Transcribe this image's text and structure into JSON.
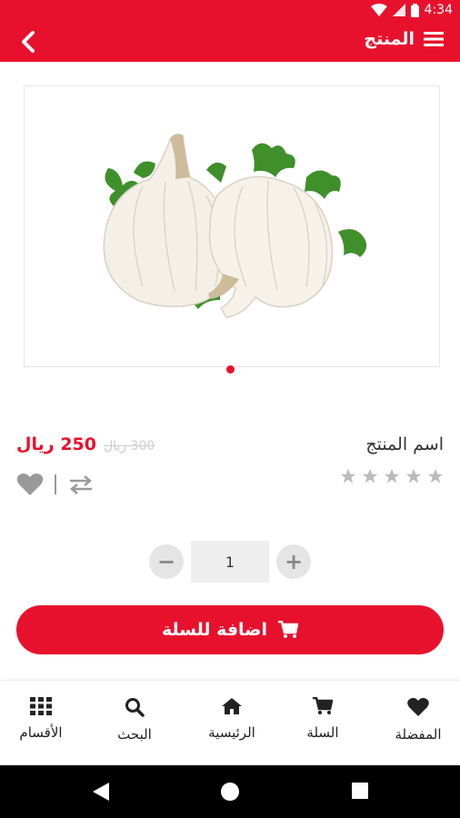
{
  "status_bar": {
    "time": "4:34"
  },
  "app_bar": {
    "title": "المنتج"
  },
  "product": {
    "name": "اسم المنتج",
    "price": "250 ريال",
    "old_price": "300 ريال",
    "rating": 0,
    "rating_max": 5,
    "image_page_count": 1,
    "image_page_current": 1
  },
  "quantity": {
    "value": "1",
    "minus_label": "−",
    "plus_label": "+"
  },
  "add_to_cart": {
    "label": "اضافة للسلة"
  },
  "bottom_nav": {
    "items": [
      {
        "label": "المفضلة",
        "icon": "heart-icon"
      },
      {
        "label": "السلة",
        "icon": "cart-icon"
      },
      {
        "label": "الرئيسية",
        "icon": "home-icon"
      },
      {
        "label": "البحث",
        "icon": "search-icon"
      },
      {
        "label": "الأقسام",
        "icon": "grid-icon"
      }
    ]
  },
  "colors": {
    "brand": "#e8112d",
    "star_empty": "#bbbbbb",
    "icon_gray": "#999999"
  }
}
